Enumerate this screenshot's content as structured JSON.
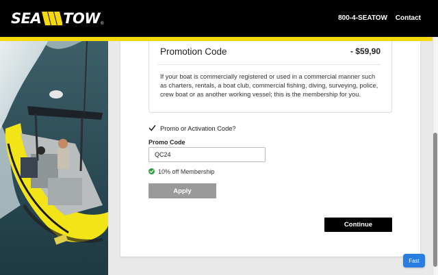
{
  "header": {
    "logo_alt": "SEA TOW",
    "logo_left": "SEA",
    "logo_right": "TOW",
    "logo_reg": "®",
    "phone": "800-4-SEATOW",
    "contact": "Contact"
  },
  "promo_card": {
    "title": "Promotion Code",
    "price": "- $59,90",
    "description": "If your boat is commercially registered or used in a commercial manner such as charters, rentals, a boat club, commercial fishing, diving, surveying, police, crew boat or as another working vessel; this is the membership for you."
  },
  "promo_form": {
    "checkbox_label": "Promo or Activation Code?",
    "checkbox_checked": true,
    "field_label": "Promo Code",
    "value": "QC24",
    "success_message": "10% off Membership",
    "apply_label": "Apply"
  },
  "continue_label": "Continue",
  "fast_badge": "Fast",
  "colors": {
    "brand_yellow": "#f5d90a",
    "header_bg": "#000000",
    "success_green": "#2e9e3e",
    "apply_disabled": "#9a9a9a",
    "fast_blue": "#2a7de1"
  },
  "icons": [
    "logo-stripes-icon",
    "checkmark-icon",
    "success-check-icon"
  ]
}
